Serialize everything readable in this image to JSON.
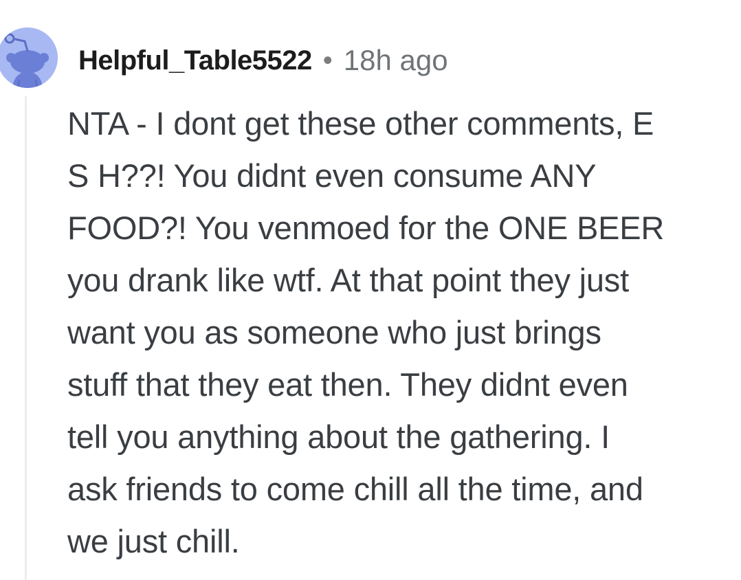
{
  "comment": {
    "author": "Helpful_Table5522",
    "separator": "•",
    "timestamp": "18h ago",
    "avatar_icon": "reddit-snoo-avatar-icon",
    "body_lines": [
      "NTA - I dont get these other comments, E",
      "S H??! You didnt even consume ANY",
      "FOOD?! You venmoed for the ONE BEER",
      "you drank like wtf. At that point they just",
      "want you as someone who just brings",
      "stuff that they eat then. They didnt even",
      "tell you anything about the gathering. I",
      "ask friends to come chill all the time, and",
      "we just chill."
    ]
  },
  "colors": {
    "avatar_bg": "#a8b8f2",
    "avatar_snoo": "#6b7fd6",
    "thread_line": "#ececec",
    "username": "#1c1c1c",
    "timestamp": "#6f7478",
    "body": "#3a3e42"
  }
}
